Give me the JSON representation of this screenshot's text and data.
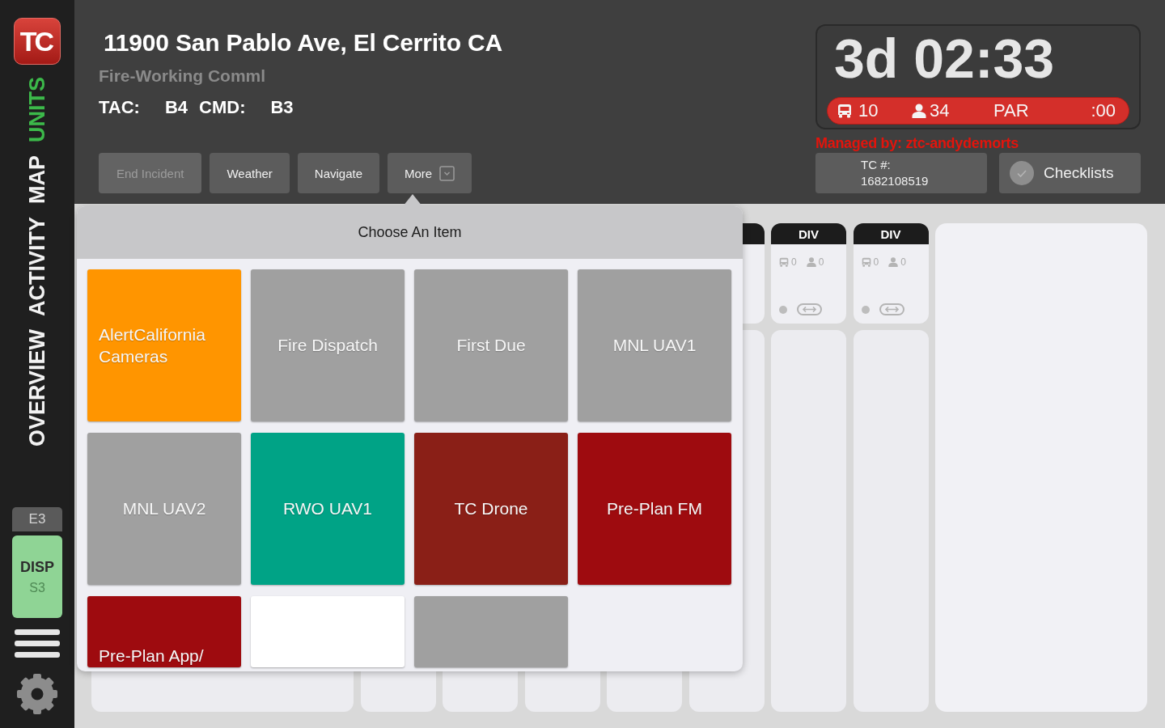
{
  "sidebar": {
    "logo": "TC",
    "nav": [
      {
        "label": "UNITS",
        "selected": true
      },
      {
        "label": "MAP",
        "selected": false
      },
      {
        "label": "ACTIVITY",
        "selected": false
      },
      {
        "label": "OVERVIEW",
        "selected": false
      }
    ],
    "badge": "E3",
    "status_card": {
      "title": "DISP",
      "subtitle": "S3"
    }
  },
  "incident": {
    "address": "11900 San Pablo Ave, El Cerrito CA",
    "type": "Fire-Working Comml",
    "channels": [
      {
        "label": "TAC:",
        "value": "B4"
      },
      {
        "label": "CMD:",
        "value": "B3"
      }
    ],
    "actions": [
      {
        "label": "End Incident",
        "kind": "plain",
        "disabled": true
      },
      {
        "label": "Weather",
        "kind": "plain",
        "disabled": false
      },
      {
        "label": "Navigate",
        "kind": "plain",
        "disabled": false
      },
      {
        "label": "More",
        "kind": "menu",
        "disabled": false
      }
    ]
  },
  "clock": {
    "elapsed": "3d 02:33",
    "units": "10",
    "personnel": "34",
    "par_label": "PAR",
    "par_timer": ":00",
    "managed_by": "Managed by: ztc-andydemorts",
    "tc_label": "TC #:",
    "tc_number": "1682108519",
    "checklists": "Checklists"
  },
  "board": {
    "columns": [
      {
        "title": "DIV",
        "units": "0",
        "personnel": "0"
      },
      {
        "title": "DIV",
        "units": "0",
        "personnel": "0"
      }
    ]
  },
  "popover": {
    "title": "Choose An Item",
    "items": [
      {
        "label": "AlertCalifornia Cameras",
        "color": "#ff9500"
      },
      {
        "label": "Fire Dispatch",
        "color": "#a0a0a0"
      },
      {
        "label": "First Due",
        "color": "#a0a0a0"
      },
      {
        "label": "MNL UAV1",
        "color": "#a0a0a0"
      },
      {
        "label": "MNL UAV2",
        "color": "#a0a0a0"
      },
      {
        "label": "RWO UAV1",
        "color": "#00a386"
      },
      {
        "label": "TC Drone",
        "color": "#8a1f17"
      },
      {
        "label": "Pre-Plan FM",
        "color": "#9e0b0f"
      },
      {
        "label": "Pre-Plan App/",
        "color": "#9e0b0f"
      },
      {
        "color": "#ffffff"
      },
      {
        "color": "#a0a0a0"
      }
    ]
  }
}
